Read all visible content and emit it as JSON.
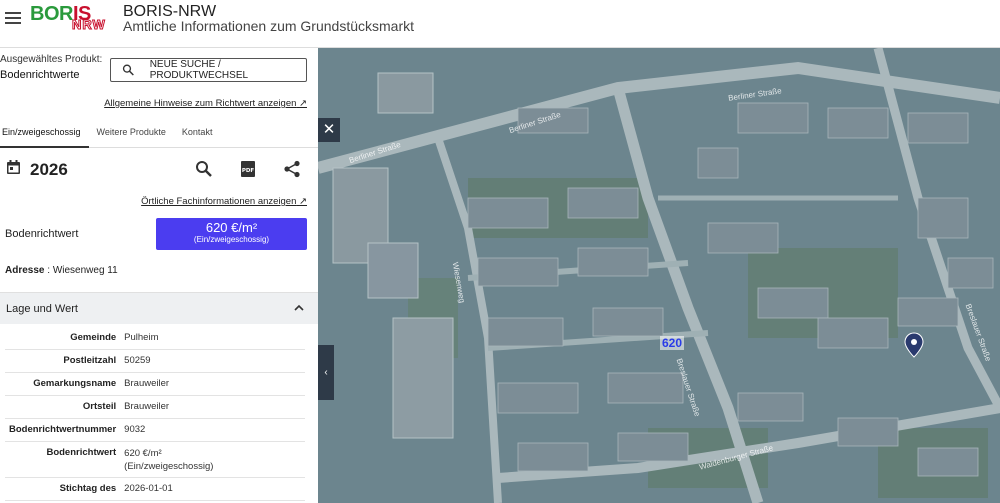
{
  "header": {
    "logo_text": "BORIS NRW",
    "title": "BORIS-NRW",
    "subtitle": "Amtliche Informationen zum Grundstücksmarkt"
  },
  "product": {
    "label": "Ausgewähltes Produkt:",
    "value": "Bodenrichtwerte",
    "search_button": "NEUE SUCHE / PRODUKTWECHSEL",
    "hint_link": "Allgemeine Hinweise zum Richtwert anzeigen"
  },
  "tabs": [
    {
      "label": "Ein/zweigeschossig",
      "active": true
    },
    {
      "label": "Weitere Produkte",
      "active": false
    },
    {
      "label": "Kontakt",
      "active": false
    }
  ],
  "detail": {
    "year": "2026",
    "local_link": "Örtliche Fachinformationen anzeigen",
    "brw_label": "Bodenrichtwert",
    "brw_value": "620 €/m²",
    "brw_sub": "(Ein/zweigeschossig)",
    "address_label": "Adresse",
    "address_value": "Wiesenweg 11"
  },
  "lage": {
    "header": "Lage und Wert",
    "rows": [
      {
        "key": "Gemeinde",
        "value": "Pulheim"
      },
      {
        "key": "Postleitzahl",
        "value": "50259"
      },
      {
        "key": "Gemarkungsname",
        "value": "Brauweiler"
      },
      {
        "key": "Ortsteil",
        "value": "Brauweiler"
      },
      {
        "key": "Bodenrichtwertnummer",
        "value": "9032"
      },
      {
        "key": "Bodenrichtwert",
        "value": "620 €/m²",
        "value2": "(Ein/zweigeschossig)"
      },
      {
        "key": "Stichtag des",
        "value": "2026-01-01"
      }
    ]
  },
  "map": {
    "brw_marker": "620",
    "streets": [
      "Berliner Straße",
      "Berliner Straße",
      "Berliner Straße",
      "Breslauer Straße",
      "Breslauer Straße",
      "Wiesenweg",
      "Waldenburger Straße"
    ]
  },
  "colors": {
    "brand_green": "#2a9a3c",
    "brand_red": "#c8102e",
    "brw_box": "#4b3df0",
    "map_control": "#2e3a48"
  }
}
